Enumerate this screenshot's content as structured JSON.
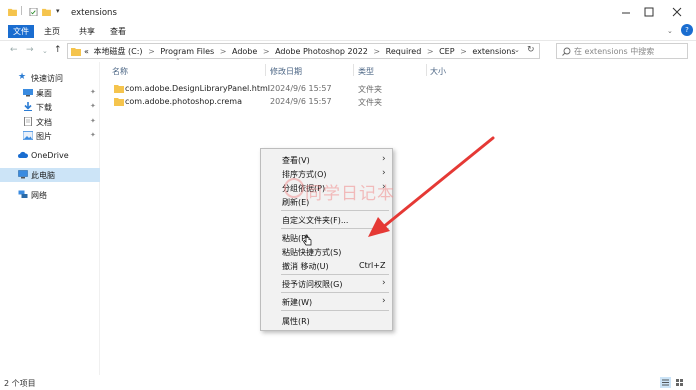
{
  "window": {
    "title": "extensions"
  },
  "ribbon": {
    "tabs": [
      {
        "label": "文件"
      },
      {
        "label": "主页"
      },
      {
        "label": "共享"
      },
      {
        "label": "查看"
      }
    ]
  },
  "address": {
    "overflow": "«",
    "crumbs": [
      "本地磁盘 (C:)",
      "Program Files",
      "Adobe",
      "Adobe Photoshop 2022",
      "Required",
      "CEP",
      "extensions"
    ],
    "separator": ">",
    "search_placeholder": "在 extensions 中搜索"
  },
  "nav": {
    "items": [
      {
        "label": "快速访问",
        "icon": "star-icon"
      },
      {
        "label": "桌面",
        "icon": "desktop-icon",
        "pinned": true
      },
      {
        "label": "下载",
        "icon": "download-icon",
        "pinned": true
      },
      {
        "label": "文档",
        "icon": "document-icon",
        "pinned": true
      },
      {
        "label": "图片",
        "icon": "picture-icon",
        "pinned": true
      },
      {
        "label": "OneDrive",
        "icon": "cloud-icon"
      },
      {
        "label": "此电脑",
        "icon": "computer-icon",
        "selected": true
      },
      {
        "label": "网络",
        "icon": "network-icon"
      }
    ]
  },
  "files": {
    "columns": [
      "名称",
      "修改日期",
      "类型",
      "大小"
    ],
    "rows": [
      {
        "name": "com.adobe.DesignLibraryPanel.html",
        "date": "2024/9/6 15:57",
        "type": "文件夹"
      },
      {
        "name": "com.adobe.photoshop.crema",
        "date": "2024/9/6 15:57",
        "type": "文件夹"
      }
    ]
  },
  "context_menu": {
    "items": [
      {
        "label": "查看(V)",
        "submenu": true
      },
      {
        "label": "排序方式(O)",
        "submenu": true
      },
      {
        "label": "分组依据(P)",
        "submenu": true
      },
      {
        "label": "刷新(E)"
      },
      {
        "label": "自定义文件夹(F)..."
      },
      {
        "label": "粘贴(P)"
      },
      {
        "label": "粘贴快捷方式(S)"
      },
      {
        "label": "撤消 移动(U)",
        "shortcut": "Ctrl+Z"
      },
      {
        "label": "授予访问权限(G)",
        "submenu": true
      },
      {
        "label": "新建(W)",
        "submenu": true
      },
      {
        "label": "属性(R)"
      }
    ],
    "arrow": "›"
  },
  "watermark": {
    "text": "同学日记本"
  },
  "status": {
    "text": "2 个项目"
  },
  "colors": {
    "accent": "#1a6dd0",
    "folder": "#f5c44d",
    "annotation_arrow": "#e53935",
    "selection": "#cce4f7"
  }
}
